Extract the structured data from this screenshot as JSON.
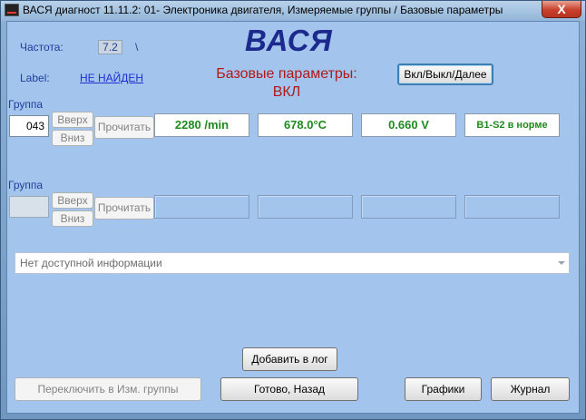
{
  "window": {
    "title": "ВАСЯ диагност 11.11.2: 01- Электроника двигателя,  Измеряемые группы / Базовые параметры",
    "close_label": "X"
  },
  "header": {
    "freq_label": "Частота:",
    "freq_value": "7.2",
    "freq_suffix": "\\",
    "label_label": "Label:",
    "label_value": "НЕ НАЙДЕН",
    "brand": "ВАСЯ",
    "mode_title_line1": "Базовые параметры:",
    "mode_title_line2": "ВКЛ",
    "toggle_button": "Вкл/Выкл/Далее"
  },
  "groups": [
    {
      "label": "Группа",
      "number": "043",
      "up_label": "Вверх",
      "down_label": "Вниз",
      "read_label": "Прочитать",
      "values": [
        "2280 /min",
        "678.0°C",
        "0.660 V",
        "B1-S2 в норме"
      ]
    },
    {
      "label": "Группа",
      "number": "",
      "up_label": "Вверх",
      "down_label": "Вниз",
      "read_label": "Прочитать",
      "values": [
        "",
        "",
        "",
        ""
      ]
    }
  ],
  "info_select": {
    "value": "Нет доступной информации"
  },
  "buttons": {
    "add_log": "Добавить в лог",
    "switch_groups": "Переключить в Изм. группы",
    "done_back": "Готово, Назад",
    "graphs": "Графики",
    "journal": "Журнал"
  }
}
